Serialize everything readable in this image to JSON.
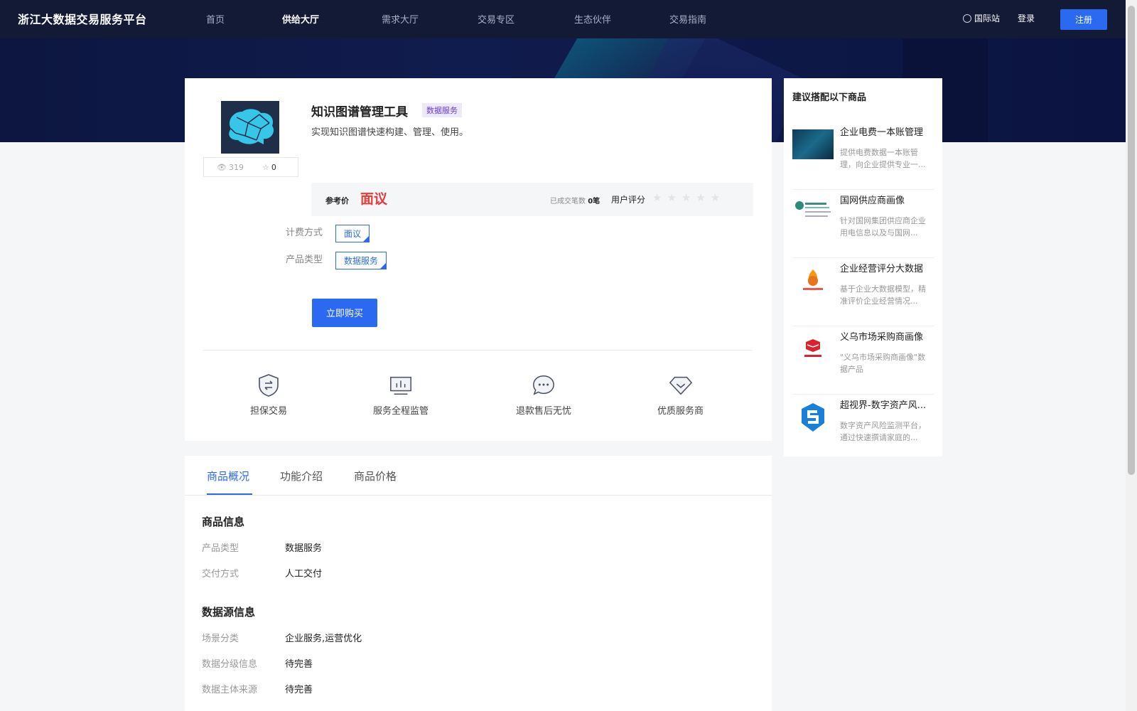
{
  "brand": "浙江大数据交易服务平台",
  "nav": {
    "items": [
      "首页",
      "供给大厅",
      "需求大厅",
      "交易专区",
      "生态伙伴",
      "交易指南"
    ],
    "active_index": 1,
    "intl": "国际站",
    "login": "登录",
    "register": "注册"
  },
  "product": {
    "title": "知识图谱管理工具",
    "tag": "数据服务",
    "description": "实现知识图谱快速构建、管理、使用。",
    "views": "319",
    "favorites": "0",
    "price_label": "参考价",
    "price_value": "面议",
    "deals_label": "已成交笔数",
    "deals_value": "0笔",
    "rating_label": "用户评分",
    "rating_stars": "★★★★★",
    "billing_label": "计费方式",
    "billing_option": "面议",
    "type_label": "产品类型",
    "type_option": "数据服务",
    "buy_label": "立即购买",
    "features": [
      "担保交易",
      "服务全程监管",
      "退款售后无忧",
      "优质服务商"
    ]
  },
  "tabs": [
    "商品概况",
    "功能介绍",
    "商品价格"
  ],
  "goods_info": {
    "title": "商品信息",
    "rows": [
      {
        "label": "产品类型",
        "value": "数据服务"
      },
      {
        "label": "交付方式",
        "value": "人工交付"
      }
    ]
  },
  "source_info": {
    "title": "数据源信息",
    "rows": [
      {
        "label": "场景分类",
        "value": "企业服务,运营优化"
      },
      {
        "label": "数据分级信息",
        "value": "待完善"
      },
      {
        "label": "数据主体来源",
        "value": "待完善"
      }
    ]
  },
  "sidebar": {
    "title": "建议搭配以下商品",
    "items": [
      {
        "name": "企业电费一本账管理",
        "desc": "提供电费数据一本账管理，向企业提供专业一..."
      },
      {
        "name": "国网供应商画像",
        "desc": "针对国网集团供应商企业用电信息以及与国网..."
      },
      {
        "name": "企业经营评分大数据",
        "desc": "基于企业大数据模型，精准评价企业经营情况..."
      },
      {
        "name": "义乌市场采购商画像",
        "desc": "\"义乌市场采购商画像\"数据产品"
      },
      {
        "name": "超视界-数字资产风...",
        "desc": "数字资产风险监测平台，通过快速撰请家庭的..."
      }
    ]
  },
  "colors": {
    "accent": "#2b6af0",
    "price": "#e83a3a",
    "nav_bg": "#131a36"
  }
}
